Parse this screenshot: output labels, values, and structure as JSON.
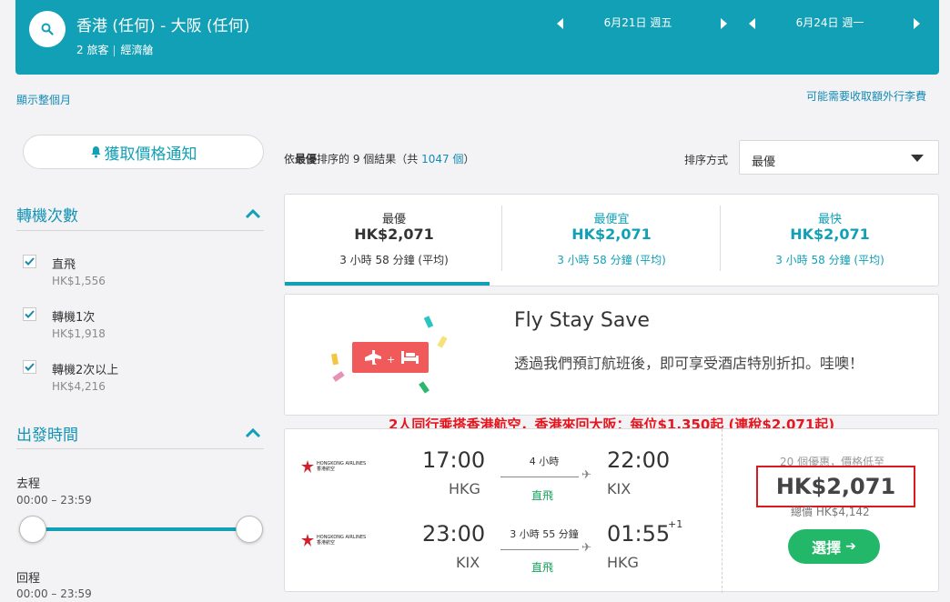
{
  "header": {
    "route": "香港 (任何) - 大阪 (任何)",
    "passengers": "2 旅客",
    "cabin": "經濟艙",
    "depart_date": "6月21日 週五",
    "return_date": "6月24日 週一"
  },
  "links": {
    "show_month": "顯示整個月",
    "extra_fees": "可能需要收取額外行李費"
  },
  "sidebar": {
    "price_alert": "獲取價格通知",
    "stops_title": "轉機次數",
    "stops": [
      {
        "label": "直飛",
        "price": "HK$1,556"
      },
      {
        "label": "轉機1次",
        "price": "HK$1,918"
      },
      {
        "label": "轉機2次以上",
        "price": "HK$4,216"
      }
    ],
    "times_title": "出發時間",
    "outbound_label": "去程",
    "outbound_range": "00:00 – 23:59",
    "return_label": "回程",
    "return_range": "00:00 – 23:59"
  },
  "results": {
    "prefix": "依",
    "sort_word": "最優",
    "middle": "排序的 9 個結果（共 ",
    "total": "1047 個",
    "suffix": "）",
    "sort_label": "排序方式",
    "sort_value": "最優"
  },
  "tabs": [
    {
      "title": "最優",
      "price": "HK$2,071",
      "duration": "3 小時 58 分鐘 (平均)"
    },
    {
      "title": "最便宜",
      "price": "HK$2,071",
      "duration": "3 小時 58 分鐘 (平均)"
    },
    {
      "title": "最快",
      "price": "HK$2,071",
      "duration": "3 小時 58 分鐘 (平均)"
    }
  ],
  "promo": {
    "title": "Fly Stay Save",
    "desc": "透過我們預訂航班後，即可享受酒店特別折扣。哇噢！"
  },
  "annotation": "2人同行乘搭香港航空，香港來回大阪：每位$1,350起 (連稅$2,071起)",
  "flight": {
    "airline_line1": "HONGKONG AIRLINES",
    "airline_line2": "香港航空",
    "outbound": {
      "dep_time": "17:00",
      "dep_code": "HKG",
      "duration": "4 小時",
      "stops": "直飛",
      "arr_time": "22:00",
      "arr_code": "KIX"
    },
    "return": {
      "dep_time": "23:00",
      "dep_code": "KIX",
      "duration": "3 小時 55 分鐘",
      "stops": "直飛",
      "arr_time": "01:55",
      "arr_code": "HKG",
      "day_offset": "+1"
    },
    "deal_text": "20 個優惠，價格低至",
    "price": "HK$2,071",
    "total": "總價 HK$4,142",
    "select_label": "選擇",
    "select_arrow": "➔"
  },
  "colors": {
    "brand_teal": "#11a0b5",
    "link_blue": "#138bb5",
    "select_green": "#23b869",
    "annotation_red": "#e8141e"
  },
  "icons": {
    "search": "search-icon",
    "bell": "bell-icon",
    "check": "checkmark-icon",
    "chevron_up": "chevron-up-icon",
    "prev": "caret-left-icon",
    "next": "caret-right-icon",
    "plane": "plane-icon"
  }
}
